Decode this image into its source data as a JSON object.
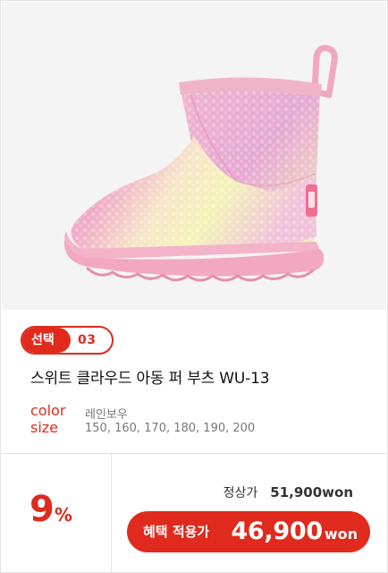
{
  "product": {
    "image_alt": "rainbow pink fur boot",
    "select_label": "선택",
    "select_number": "03",
    "name": "스위트 클라우드 아동 퍼 부츠 WU-13",
    "color_key": "color",
    "color_value": "레인보우",
    "size_key": "size",
    "size_value": "150, 160, 170, 180, 190, 200"
  },
  "pricing": {
    "discount_number": "9",
    "discount_sign": "%",
    "regular_label": "정상가",
    "regular_price": "51,900",
    "regular_unit": "won",
    "benefit_label": "혜택 적용가",
    "benefit_price": "46,900",
    "benefit_unit": "won"
  },
  "colors": {
    "accent": "#e02a1d",
    "boot_pink": "#f2b6cd",
    "boot_yellow": "#f5f2b0",
    "background": "#f4f4f4"
  }
}
